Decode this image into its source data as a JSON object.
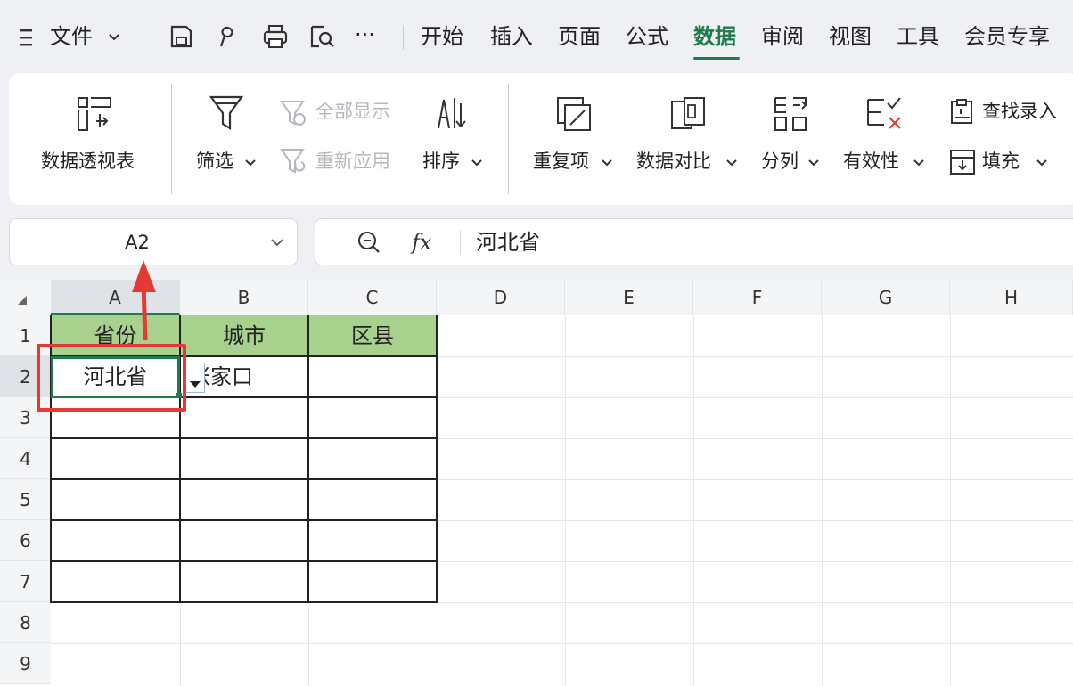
{
  "menu": {
    "hamburger_label": "文件",
    "tabs": [
      "开始",
      "插入",
      "页面",
      "公式",
      "数据",
      "审阅",
      "视图",
      "工具",
      "会员专享"
    ],
    "active_tab_index": 4,
    "more_label": "···"
  },
  "ribbon": {
    "pivot_label": "数据透视表",
    "filter_label": "筛选",
    "show_all_label": "全部显示",
    "reapply_label": "重新应用",
    "sort_label": "排序",
    "duplicates_label": "重复项",
    "compare_label": "数据对比",
    "split_label": "分列",
    "validity_label": "有效性",
    "lookup_label": "查找录入",
    "fill_label": "填充"
  },
  "name_box": {
    "value": "A2"
  },
  "formula_bar": {
    "fx_label": "fx",
    "value": "河北省"
  },
  "sheet": {
    "columns": [
      "A",
      "B",
      "C",
      "D",
      "E",
      "F",
      "G",
      "H"
    ],
    "rows": [
      "1",
      "2",
      "3",
      "4",
      "5",
      "6",
      "7",
      "8",
      "9"
    ],
    "cells": {
      "A1": "省份",
      "B1": "城市",
      "C1": "区县",
      "A2": "河北省",
      "B2": "张家口",
      "C2": ""
    },
    "selected_cell": "A2"
  },
  "colors": {
    "accent": "#1f7a4c",
    "header_fill": "#a9d18e",
    "highlight": "#e53935"
  }
}
